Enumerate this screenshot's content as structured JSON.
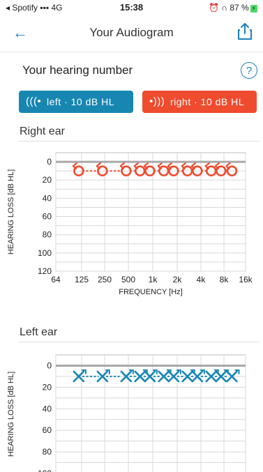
{
  "status": {
    "left": "◂ Spotify ▪▪▪ 4G",
    "time": "15:38",
    "right": "⏰ ∩ 87 %",
    "battery": "⚡"
  },
  "nav": {
    "title": "Your Audiogram"
  },
  "hearing_number": {
    "label": "Your hearing number",
    "help": "?"
  },
  "buttons": {
    "left": "left · 10 dB HL",
    "right": "right · 10 dB HL"
  },
  "sections": {
    "right": "Right ear",
    "left": "Left ear"
  },
  "axes": {
    "y_title": "HEARING LOSS [dB HL]",
    "x_title": "FREQUENCY [Hz]",
    "y_ticks": [
      "0",
      "20",
      "40",
      "60",
      "80",
      "100",
      "120"
    ],
    "x_ticks": [
      "64",
      "125",
      "250",
      "500",
      "1k",
      "2k",
      "4k",
      "8k",
      "16k"
    ]
  },
  "colors": {
    "right": "#ef4b2f",
    "left": "#1787b2",
    "grid": "#bdbdbd",
    "accent": "#1d7fb8"
  },
  "chart_data": [
    {
      "type": "line",
      "title": "Right ear",
      "xlabel": "FREQUENCY [Hz]",
      "ylabel": "HEARING LOSS [dB HL]",
      "x": [
        125,
        250,
        500,
        750,
        1000,
        1500,
        2000,
        3000,
        4000,
        6000,
        8000,
        11000
      ],
      "series": [
        {
          "values": [
            10,
            10,
            10,
            10,
            10,
            10,
            10,
            10,
            10,
            10,
            10,
            10
          ]
        }
      ],
      "ylim": [
        120,
        -10
      ],
      "yscale": "linear_inverted",
      "xscale": "log"
    },
    {
      "type": "line",
      "title": "Left ear",
      "xlabel": "",
      "ylabel": "HEARING LOSS [dB HL]",
      "x": [
        125,
        250,
        500,
        750,
        1000,
        1500,
        2000,
        3000,
        4000,
        6000,
        8000,
        11000
      ],
      "series": [
        {
          "values": [
            10,
            10,
            10,
            10,
            10,
            10,
            10,
            10,
            10,
            10,
            10,
            10
          ]
        }
      ],
      "ylim": [
        100,
        -10
      ],
      "yscale": "linear_inverted",
      "xscale": "log"
    }
  ]
}
